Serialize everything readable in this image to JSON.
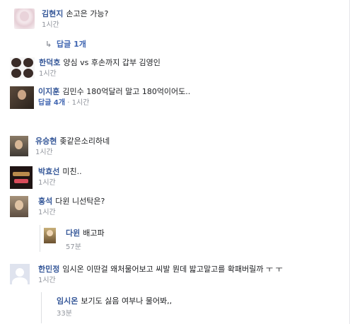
{
  "comments": [
    {
      "name": "김현지",
      "text": "손고은 가능?",
      "time": "1시간",
      "replies": "답글 1개"
    },
    {
      "name": "한덕호",
      "text": "양심 vs 후손까지 갑부 김영인",
      "time": "1시간"
    },
    {
      "name": "이지훈",
      "text": "김민수 180억달러 말고 180억이어도..",
      "reply_count": "답글 4개",
      "dot": "·",
      "time": "1시간"
    },
    {
      "name": "유승현",
      "text": "좆같은소리하네",
      "time": "1시간"
    },
    {
      "name": "박효선",
      "text": "미친..",
      "time": "1시간"
    },
    {
      "name": "홍석",
      "text": "다윈 니선탁은?",
      "time": "1시간"
    },
    {
      "name": "다윈",
      "text": "배고파",
      "time": "57분"
    },
    {
      "name": "한민정",
      "text": "임시온 이딴걸 왜처물어보고 씨발 뭔데 밟고말고를 확패버릴까 ㅜ ㅜ",
      "time": "1시간"
    },
    {
      "name": "임시온",
      "text": "보기도 싫음 여부나 물어봐,,",
      "time": "33분"
    }
  ],
  "colors": {
    "name": "#365899",
    "meta": "#90949c",
    "link": "#4267b2"
  }
}
